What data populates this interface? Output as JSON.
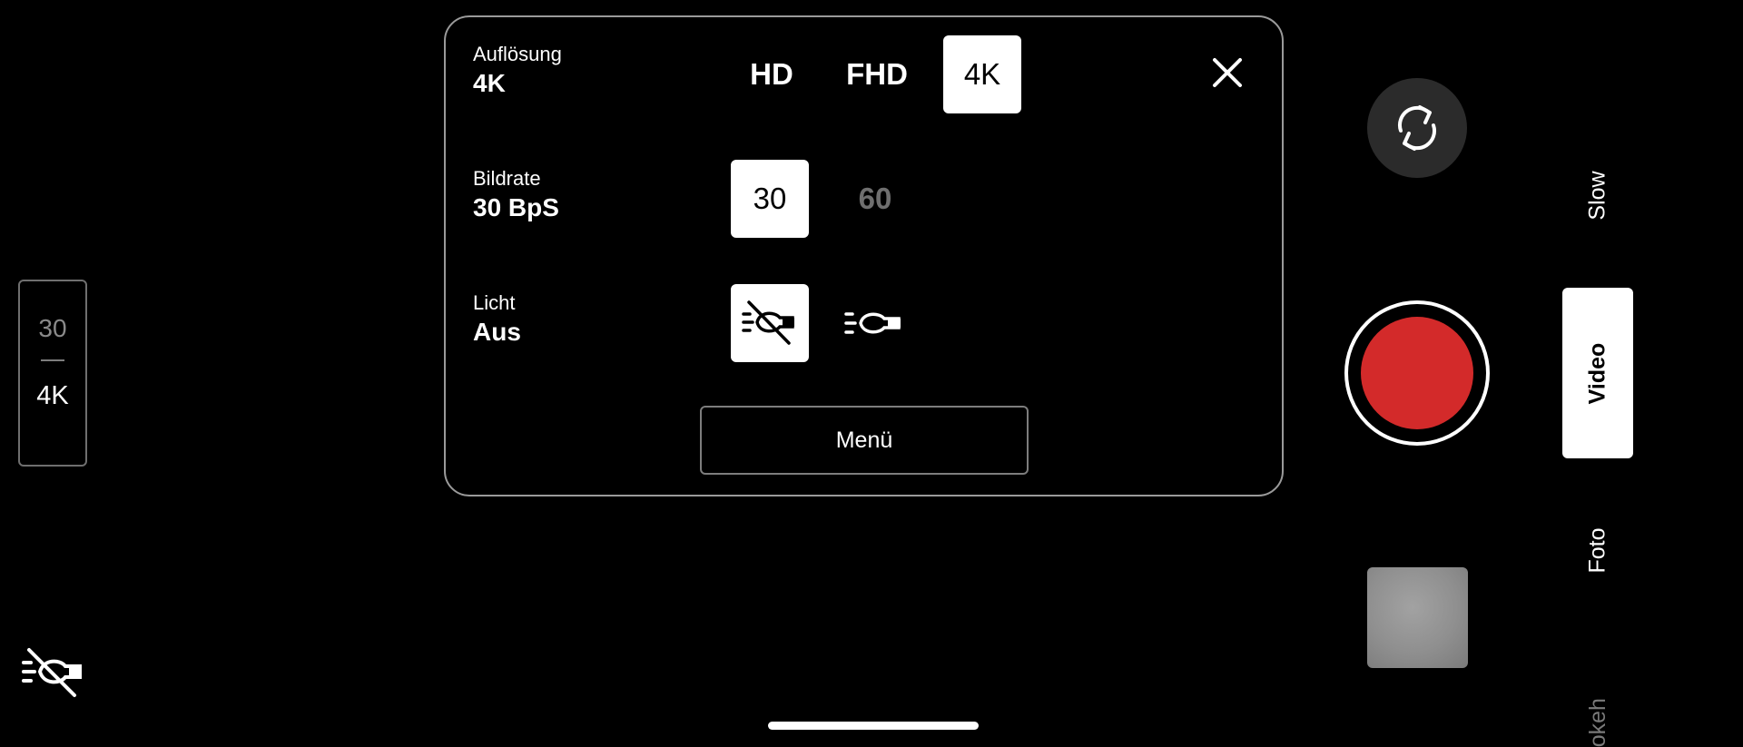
{
  "left_indicator": {
    "fps": "30",
    "resolution": "4K"
  },
  "left_light_icon": "flash-off-icon",
  "settings_panel": {
    "resolution": {
      "caption": "Auflösung",
      "value": "4K",
      "options": [
        "HD",
        "FHD",
        "4K"
      ],
      "selected": "4K"
    },
    "frame_rate": {
      "caption": "Bildrate",
      "value": "30 BpS",
      "options": [
        "30",
        "60"
      ],
      "selected": "30",
      "disabled": [
        "60"
      ]
    },
    "light": {
      "caption": "Licht",
      "value": "Aus",
      "options": [
        "light-off-icon",
        "light-on-icon"
      ],
      "selected": "light-off-icon"
    },
    "menu_label": "Menü",
    "close_icon": "close-icon"
  },
  "controls": {
    "flip_icon": "switch-camera-icon",
    "record_color": "#d32a2a"
  },
  "modes": [
    {
      "label": "Slow",
      "state": "normal"
    },
    {
      "label": "Video",
      "state": "active"
    },
    {
      "label": "Foto",
      "state": "normal"
    },
    {
      "label": "Bokeh",
      "state": "faded"
    }
  ]
}
